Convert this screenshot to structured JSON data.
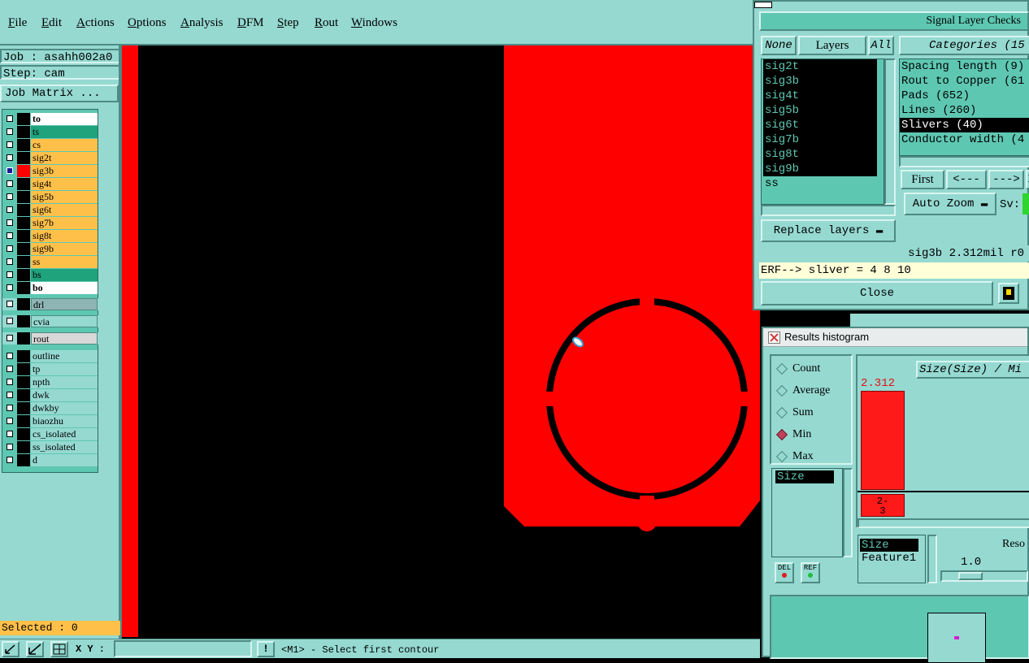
{
  "menu": [
    "File",
    "Edit",
    "Actions",
    "Options",
    "Analysis",
    "DFM",
    "Step",
    "Rout",
    "Windows"
  ],
  "left": {
    "job": "Job : asahh002a0",
    "step": "Step: cam",
    "job_matrix": "Job Matrix ...",
    "selected": "Selected : 0"
  },
  "layers": [
    {
      "name": "to",
      "bg": "#ffffff"
    },
    {
      "name": "ts",
      "bg": "#1ea37c"
    },
    {
      "name": "cs",
      "bg": "#ffc04a"
    },
    {
      "name": "sig2t",
      "bg": "#ffc04a"
    },
    {
      "name": "sig3b",
      "bg": "#ffc04a"
    },
    {
      "name": "sig4t",
      "bg": "#ffc04a"
    },
    {
      "name": "sig5b",
      "bg": "#ffc04a"
    },
    {
      "name": "sig6t",
      "bg": "#ffc04a"
    },
    {
      "name": "sig7b",
      "bg": "#ffc04a"
    },
    {
      "name": "sig8t",
      "bg": "#ffc04a"
    },
    {
      "name": "sig9b",
      "bg": "#ffc04a"
    },
    {
      "name": "ss",
      "bg": "#ffc04a"
    },
    {
      "name": "bs",
      "bg": "#1ea37c"
    },
    {
      "name": "bo",
      "bg": "#ffffff"
    }
  ],
  "misc_layers": [
    {
      "name": "drl",
      "bg": "#8fb4b4"
    },
    {
      "name": "cvia",
      "bg": "#95d9d1"
    },
    {
      "name": "rout",
      "bg": "#d8d8d8"
    }
  ],
  "aux_layers": [
    "outline",
    "tp",
    "npth",
    "dwk",
    "dwkby",
    "biaozhu",
    "cs_isolated",
    "ss_isolated",
    "d"
  ],
  "bottom": {
    "xy_label": "X Y :",
    "excl": "!",
    "prompt": "<M1> - Select first contour"
  },
  "slc": {
    "title": "Signal Layer Checks",
    "none": "None",
    "layers": "Layers",
    "all": "All",
    "categories_header": "Categories (15",
    "layer_items": [
      "sig2t",
      "sig3b",
      "sig4t",
      "sig5b",
      "sig6t",
      "sig7b",
      "sig8t",
      "sig9b",
      "ss"
    ],
    "categories": [
      "Spacing length (9)",
      "Rout to Copper (61",
      "Pads (652)",
      "Lines (260)",
      "Slivers (40)",
      "Conductor width (4"
    ],
    "first": "First",
    "prev": "<---",
    "next": "--->",
    "next_cut": "I",
    "auto_zoom": "Auto Zoom",
    "sv": "Sv:",
    "replace_layers": "Replace layers",
    "status": "sig3b 2.312mil  r0",
    "erf": "ERF--> sliver = 4 8 10",
    "close": "Close"
  },
  "hist": {
    "title": "Results histogram",
    "radios": [
      "Count",
      "Average",
      "Sum",
      "Min",
      "Max"
    ],
    "selected_radio": "Min",
    "chart_title": "Size(Size) / Mi",
    "bar_value": "2.312",
    "bar_label_top": "2-",
    "bar_label_bottom": "3",
    "size_list": [
      "Size"
    ],
    "attr_list": [
      "Size",
      "Feature1"
    ],
    "reso_label": "Reso",
    "reso_value": "1.0",
    "del": "DEL",
    "ref": "REF"
  },
  "colors": {
    "teal": "#95d9d1",
    "copper": "#ff0000",
    "highlight": "#ffc04a"
  }
}
